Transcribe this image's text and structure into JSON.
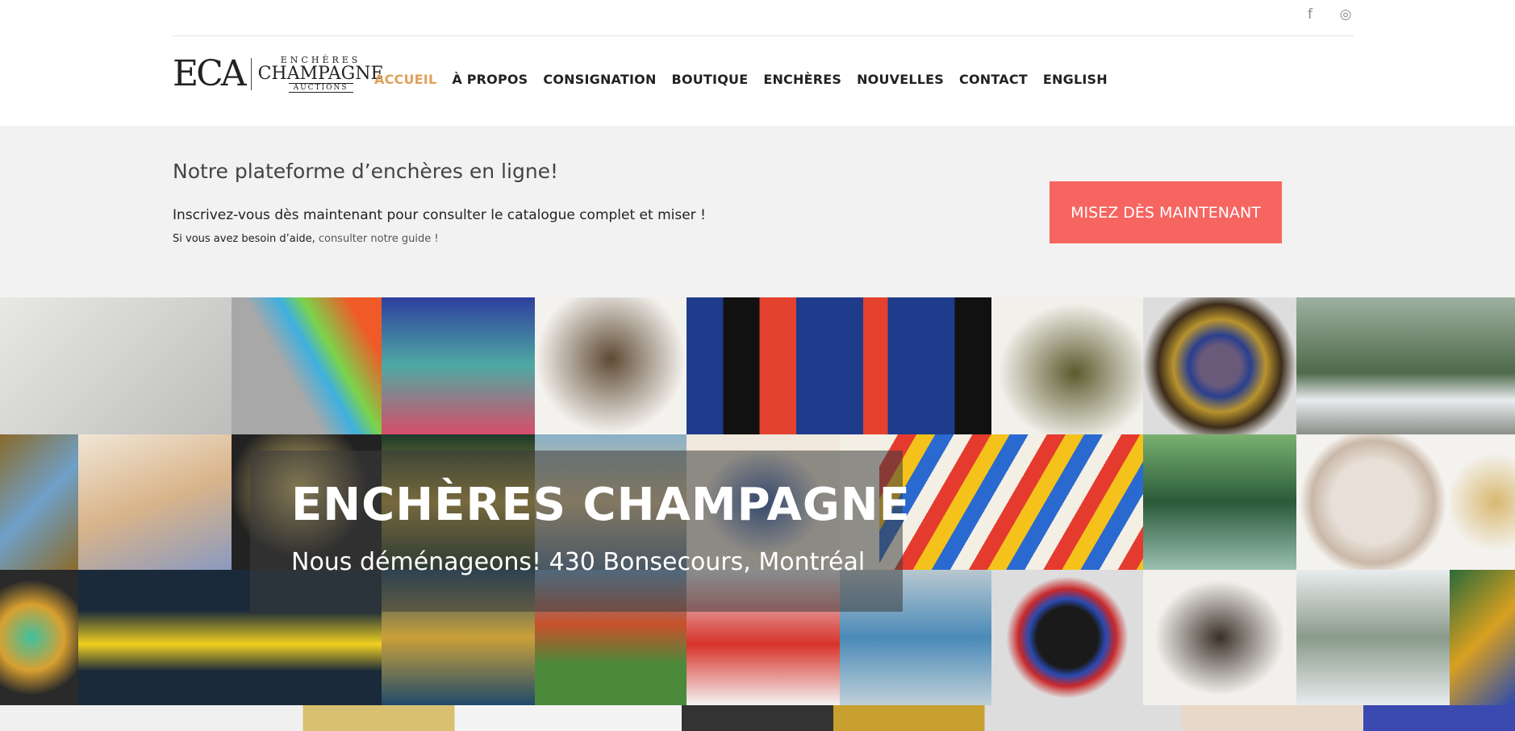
{
  "social": {
    "facebook_icon": "facebook-icon",
    "instagram_icon": "instagram-icon"
  },
  "logo": {
    "mark": "ECA",
    "line1": "ENCHÈRES",
    "line2": "CHAMPAGNE",
    "line3": "AUCTIONS"
  },
  "nav": [
    {
      "label": "Accueil",
      "active": true
    },
    {
      "label": "À propos"
    },
    {
      "label": "Consignation"
    },
    {
      "label": "Boutique"
    },
    {
      "label": "Enchères"
    },
    {
      "label": "Nouvelles"
    },
    {
      "label": "Contact"
    },
    {
      "label": "English"
    }
  ],
  "promo": {
    "title": "Notre plateforme d’enchères en ligne!",
    "line1": "Inscrivez-vous dès maintenant pour consulter le catalogue complet et miser !",
    "line2_prefix": "Si vous avez besoin d’aide, ",
    "line2_link": "consulter notre guide !",
    "cta": "MISEZ DÈS MAINTENANT"
  },
  "hero": {
    "title": "ENCHÈRES CHAMPAGNE",
    "subtitle": "Nous déménageons! 430 Bonsecours, Montréal"
  },
  "colors": {
    "accent": "#e0a05b",
    "cta": "#f66560",
    "promo_bg": "#f2f2f2"
  }
}
